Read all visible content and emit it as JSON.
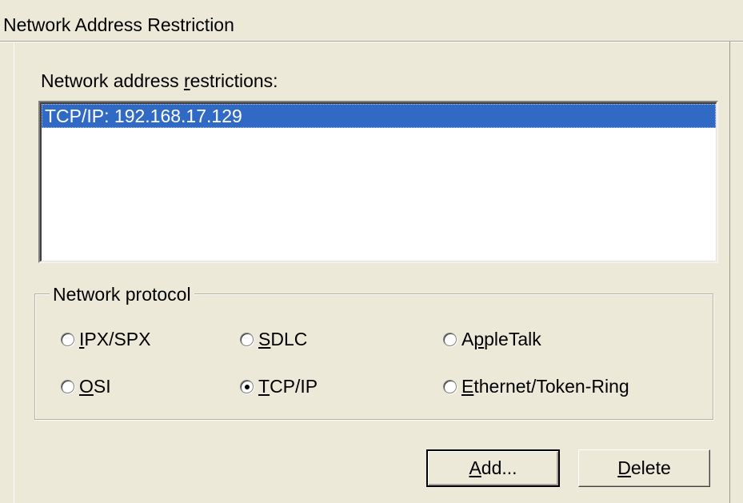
{
  "panel": {
    "title": "Network Address Restriction"
  },
  "restrictions": {
    "label_pre": "Network address ",
    "label_accel": "r",
    "label_post": "estrictions:",
    "items": [
      {
        "text": "TCP/IP: 192.168.17.129",
        "selected": true
      }
    ]
  },
  "protocol_group": {
    "legend": "Network protocol",
    "options": [
      {
        "id": "ipx-spx",
        "accel": "I",
        "rest": "PX/SPX",
        "checked": false
      },
      {
        "id": "sdlc",
        "accel": "S",
        "rest": "DLC",
        "checked": false
      },
      {
        "id": "appletalk",
        "pre": "A",
        "accel": "p",
        "rest": "pleTalk",
        "checked": false
      },
      {
        "id": "osi",
        "accel": "O",
        "rest": "SI",
        "checked": false
      },
      {
        "id": "tcp-ip",
        "accel": "T",
        "rest": "CP/IP",
        "checked": true
      },
      {
        "id": "ethernet-token-ring",
        "accel": "E",
        "rest": "thernet/Token-Ring",
        "checked": false
      }
    ]
  },
  "buttons": {
    "add": {
      "accel": "A",
      "rest": "dd..."
    },
    "delete": {
      "accel": "D",
      "rest": "elete"
    }
  }
}
